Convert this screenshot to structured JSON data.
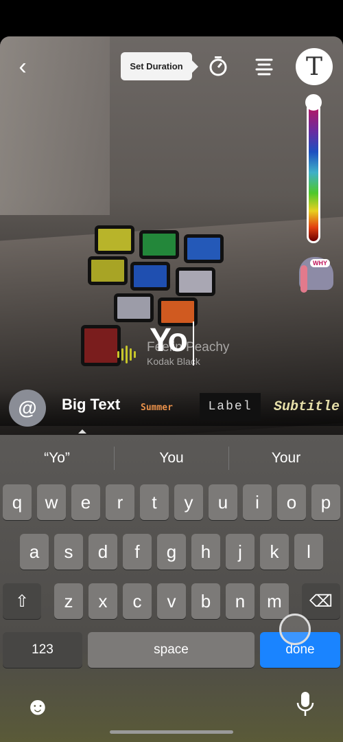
{
  "toolbar": {
    "tooltip": "Set Duration",
    "icons": [
      "back-chevron-icon",
      "timer-icon",
      "align-icon",
      "text-style-icon"
    ],
    "text_button": "T"
  },
  "color_slider": {
    "value": 0,
    "top_color": "#c0135a"
  },
  "sticker": {
    "text": "WHY"
  },
  "caption": {
    "text": "Yo"
  },
  "music": {
    "song": "Feelin Peachy",
    "artist": "Kodak Black",
    "accent": "#c7c62a"
  },
  "text_styles": {
    "mention": "@",
    "items": [
      "Big Text",
      "Summer",
      "Label",
      "Subtitle"
    ],
    "selected": "Big Text"
  },
  "suggestions": [
    "“Yo”",
    "You",
    "Your"
  ],
  "keyboard": {
    "row1": [
      "q",
      "w",
      "e",
      "r",
      "t",
      "y",
      "u",
      "i",
      "o",
      "p"
    ],
    "row2": [
      "a",
      "s",
      "d",
      "f",
      "g",
      "h",
      "j",
      "k",
      "l"
    ],
    "row3": [
      "z",
      "x",
      "c",
      "v",
      "b",
      "n",
      "m"
    ],
    "numbers": "123",
    "space": "space",
    "done": "done",
    "shift": "⇧",
    "delete": "⌫",
    "emoji": "☻",
    "mic": "🎙",
    "done_color": "#1a84ff"
  }
}
